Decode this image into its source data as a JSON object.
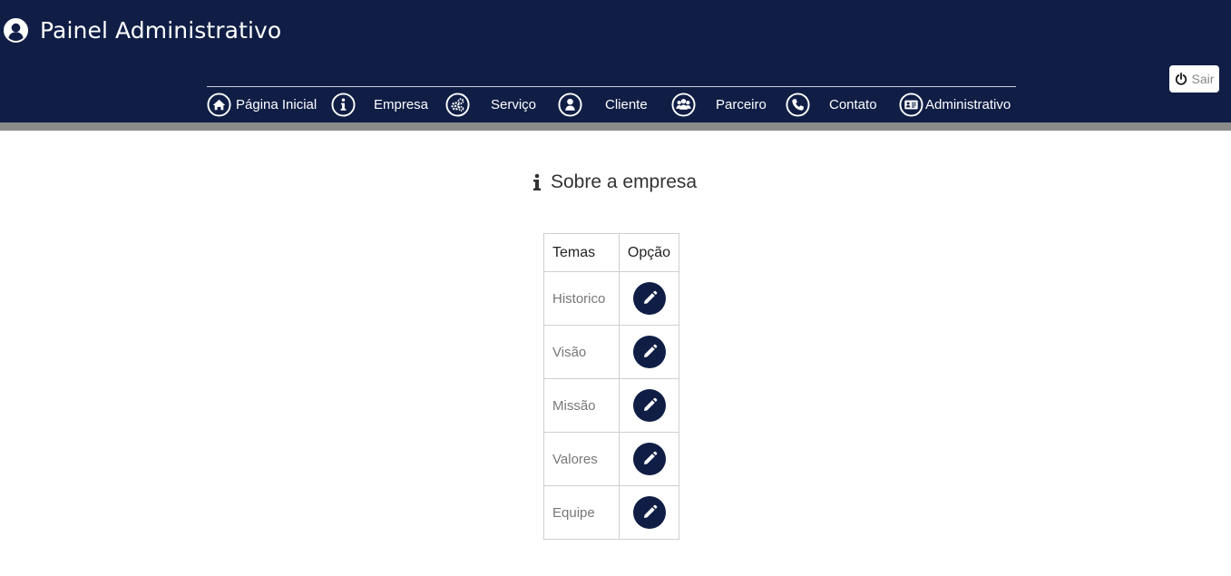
{
  "header": {
    "title": "Painel Administrativo",
    "brand_icon": "user-circle-icon",
    "background_color": "#101e46",
    "logout": {
      "label": "Sair",
      "icon": "power-icon"
    }
  },
  "nav": {
    "items": [
      {
        "label": "Página Inicial",
        "icon": "home-icon"
      },
      {
        "label": "Empresa",
        "icon": "info-icon"
      },
      {
        "label": "Serviço",
        "icon": "gears-icon"
      },
      {
        "label": "Cliente",
        "icon": "user-icon"
      },
      {
        "label": "Parceiro",
        "icon": "users-icon"
      },
      {
        "label": "Contato",
        "icon": "phone-icon"
      },
      {
        "label": "Administrativo",
        "icon": "id-card-icon"
      }
    ]
  },
  "main": {
    "section_title": "Sobre a empresa",
    "section_icon": "info-icon",
    "table": {
      "headers": [
        "Temas",
        "Opção"
      ],
      "rows": [
        {
          "name": "Historico",
          "action_icon": "pencil-icon"
        },
        {
          "name": "Visão",
          "action_icon": "pencil-icon"
        },
        {
          "name": "Missão",
          "action_icon": "pencil-icon"
        },
        {
          "name": "Valores",
          "action_icon": "pencil-icon"
        },
        {
          "name": "Equipe",
          "action_icon": "pencil-icon"
        }
      ]
    }
  }
}
